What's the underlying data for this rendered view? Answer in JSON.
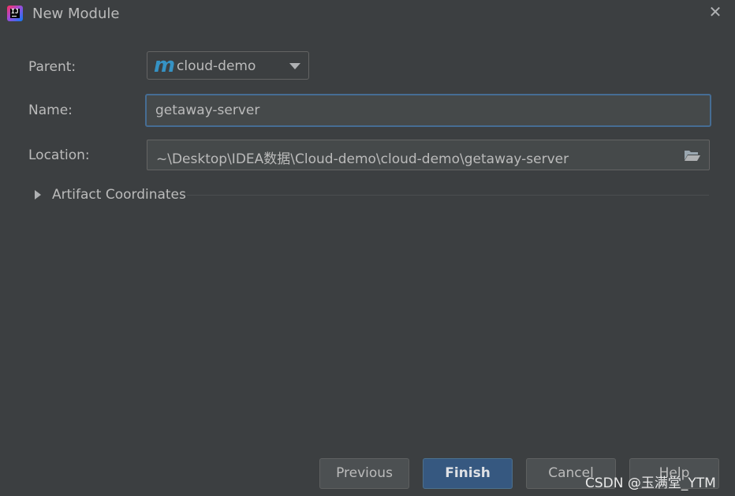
{
  "window": {
    "title": "New Module",
    "close_symbol": "✕"
  },
  "form": {
    "parent_label": "Parent:",
    "parent_value": "cloud-demo",
    "parent_icon_glyph": "m",
    "name_label": "Name:",
    "name_value": "getaway-server",
    "location_label": "Location:",
    "location_value": "~\\Desktop\\IDEA数据\\Cloud-demo\\cloud-demo\\getaway-server"
  },
  "artifact": {
    "label": "Artifact Coordinates",
    "expanded": false
  },
  "buttons": {
    "previous": "Previous",
    "finish": "Finish",
    "cancel": "Cancel",
    "help": "Help"
  },
  "watermark": "CSDN @玉满堂_YTM",
  "colors": {
    "background": "#3c3f41",
    "focus_border": "#466d94",
    "primary_button": "#365880",
    "maven_icon": "#3592c4"
  },
  "icons": [
    "intellij-idea-icon",
    "close-icon",
    "maven-module-icon",
    "chevron-down-icon",
    "folder-open-icon",
    "expand-triangle-icon"
  ]
}
